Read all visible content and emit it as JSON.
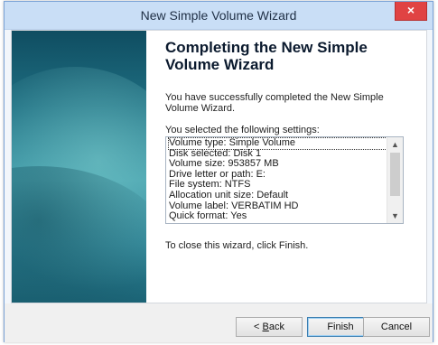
{
  "window": {
    "title": "New Simple Volume Wizard",
    "close_glyph": "×"
  },
  "wizard": {
    "heading": "Completing the New Simple Volume Wizard",
    "intro": "You have successfully completed the New Simple Volume Wizard.",
    "selected_label": "You selected the following settings:",
    "settings": [
      "Volume type: Simple Volume",
      "Disk selected: Disk 1",
      "Volume size: 953857 MB",
      "Drive letter or path: E:",
      "File system: NTFS",
      "Allocation unit size: Default",
      "Volume label: VERBATIM HD",
      "Quick format: Yes"
    ],
    "closing_text": "To close this wizard, click Finish."
  },
  "buttons": {
    "back_accel": "B",
    "back_rest": "ack",
    "back_prefix": "< ",
    "finish": "Finish",
    "cancel": "Cancel"
  },
  "icons": {
    "scroll_up": "chevron-up-icon",
    "scroll_down": "chevron-down-icon"
  }
}
